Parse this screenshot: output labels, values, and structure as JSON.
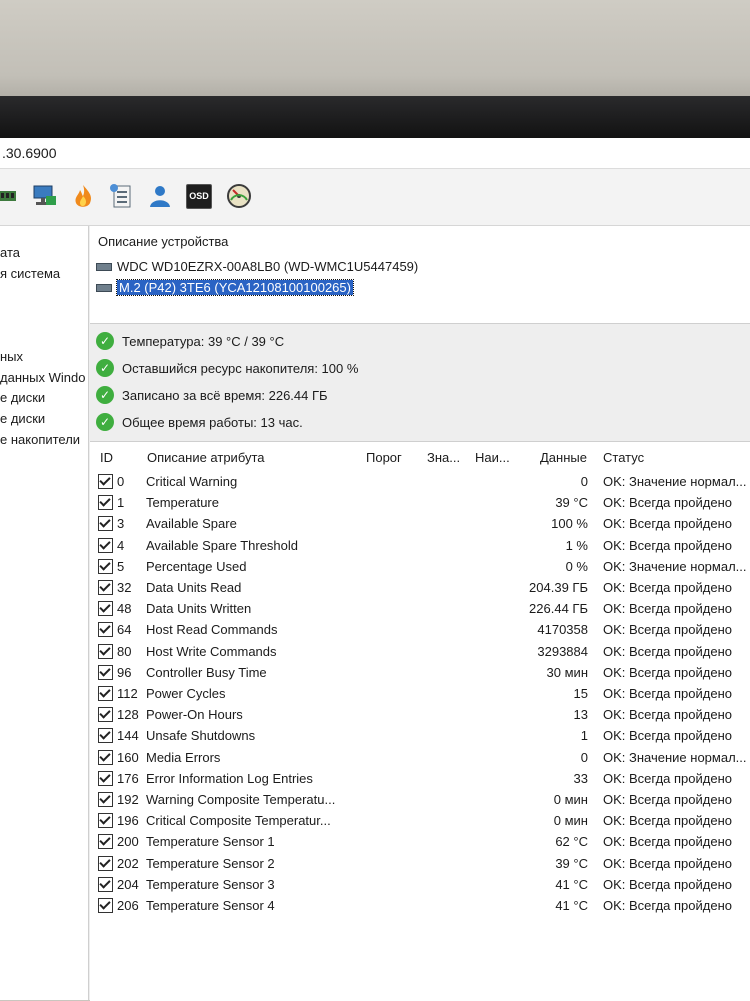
{
  "title": ".30.6900",
  "toolbar": {
    "icons": [
      "memory-icon",
      "network-icon",
      "flame-icon",
      "task-icon",
      "user-icon",
      "osd-icon",
      "gauge-icon"
    ],
    "osd_label": "OSD"
  },
  "leftnav": {
    "items": [
      "ата",
      "я система",
      "",
      "",
      "",
      "ных",
      "данных Windo",
      "е диски",
      "е диски",
      "е накопители"
    ]
  },
  "device_panel": {
    "heading": "Описание устройства",
    "devices": [
      {
        "label": "WDC WD10EZRX-00A8LB0 (WD-WMC1U5447459)",
        "selected": false
      },
      {
        "label": "M.2 (P42) 3TE6 (YCA1210810010026​5)",
        "selected": true
      }
    ]
  },
  "summary": [
    "Температура: 39 °C / 39 °C",
    "Оставшийся ресурс накопителя: 100 %",
    "Записано за всё время: 226.44 ГБ",
    "Общее время работы: 13 час."
  ],
  "table": {
    "headers": {
      "id": "ID",
      "name": "Описание атрибута",
      "threshold": "Порог",
      "value": "Зна...",
      "worst": "Наи...",
      "data": "Данные",
      "status": "Статус"
    },
    "rows": [
      {
        "id": "0",
        "name": "Critical Warning",
        "data": "0",
        "status": "OK: Значение нормал..."
      },
      {
        "id": "1",
        "name": "Temperature",
        "data": "39 °C",
        "status": "OK: Всегда пройдено"
      },
      {
        "id": "3",
        "name": "Available Spare",
        "data": "100 %",
        "status": "OK: Всегда пройдено"
      },
      {
        "id": "4",
        "name": "Available Spare Threshold",
        "data": "1 %",
        "status": "OK: Всегда пройдено"
      },
      {
        "id": "5",
        "name": "Percentage Used",
        "data": "0 %",
        "status": "OK: Значение нормал..."
      },
      {
        "id": "32",
        "name": "Data Units Read",
        "data": "204.39 ГБ",
        "status": "OK: Всегда пройдено"
      },
      {
        "id": "48",
        "name": "Data Units Written",
        "data": "226.44 ГБ",
        "status": "OK: Всегда пройдено"
      },
      {
        "id": "64",
        "name": "Host Read Commands",
        "data": "4170358",
        "status": "OK: Всегда пройдено"
      },
      {
        "id": "80",
        "name": "Host Write Commands",
        "data": "3293884",
        "status": "OK: Всегда пройдено"
      },
      {
        "id": "96",
        "name": "Controller Busy Time",
        "data": "30 мин",
        "status": "OK: Всегда пройдено"
      },
      {
        "id": "112",
        "name": "Power Cycles",
        "data": "15",
        "status": "OK: Всегда пройдено"
      },
      {
        "id": "128",
        "name": "Power-On Hours",
        "data": "13",
        "status": "OK: Всегда пройдено"
      },
      {
        "id": "144",
        "name": "Unsafe Shutdowns",
        "data": "1",
        "status": "OK: Всегда пройдено"
      },
      {
        "id": "160",
        "name": "Media Errors",
        "data": "0",
        "status": "OK: Значение нормал..."
      },
      {
        "id": "176",
        "name": "Error Information Log Entries",
        "data": "33",
        "status": "OK: Всегда пройдено"
      },
      {
        "id": "192",
        "name": "Warning Composite Temperatu...",
        "data": "0 мин",
        "status": "OK: Всегда пройдено"
      },
      {
        "id": "196",
        "name": "Critical Composite Temperatur...",
        "data": "0 мин",
        "status": "OK: Всегда пройдено"
      },
      {
        "id": "200",
        "name": "Temperature Sensor 1",
        "data": "62 °C",
        "status": "OK: Всегда пройдено"
      },
      {
        "id": "202",
        "name": "Temperature Sensor 2",
        "data": "39 °C",
        "status": "OK: Всегда пройдено"
      },
      {
        "id": "204",
        "name": "Temperature Sensor 3",
        "data": "41 °C",
        "status": "OK: Всегда пройдено"
      },
      {
        "id": "206",
        "name": "Temperature Sensor 4",
        "data": "41 °C",
        "status": "OK: Всегда пройдено"
      }
    ]
  },
  "colors": {
    "selection": "#2a63c4",
    "ok_check": "#3fae3f"
  }
}
